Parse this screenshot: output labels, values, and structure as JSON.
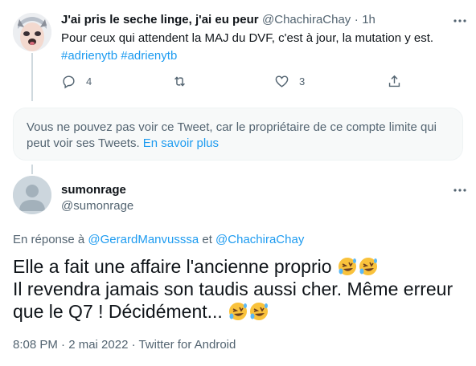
{
  "tweet1": {
    "display_name": "J'ai pris le seche linge, j'ai eu peur",
    "handle": "@ChachiraChay",
    "separator": "·",
    "time": "1h",
    "text": "Pour ceux qui attendent la MAJ du DVF, c'est à jour, la mutation y est.",
    "hashtags": [
      "#adrienytb",
      "#adrienytb"
    ],
    "actions": {
      "reply_count": "4",
      "retweet_count": "",
      "like_count": "3"
    }
  },
  "restricted_notice": {
    "line1": "Vous ne pouvez pas voir ce Tweet, car le propriétaire de ce compte limite qui",
    "line2": "peut voir ses Tweets.",
    "link": "En savoir plus"
  },
  "tweet2": {
    "display_name": "sumonrage",
    "handle": "@sumonrage",
    "reply_prefix": "En réponse à",
    "mentions": [
      "@GerardManvusssa",
      "@ChachiraChay"
    ],
    "mention_joiner": "et",
    "text_line1": "Elle a fait une affaire l'ancienne proprio",
    "text_line2": "Il revendra jamais son taudis aussi cher. Même erreur",
    "text_line3": "que le Q7 ! Décidément...",
    "emoji_name": "rolling-on-the-floor-laughing",
    "timestamp": "8:08 PM · 2 mai 2022 · Twitter for Android"
  },
  "colors": {
    "accent": "#1d9bf0",
    "secondary_text": "#536471",
    "primary_text": "#0f1419",
    "thread_line": "#cfd9de",
    "notice_bg": "#f7f9f9"
  }
}
